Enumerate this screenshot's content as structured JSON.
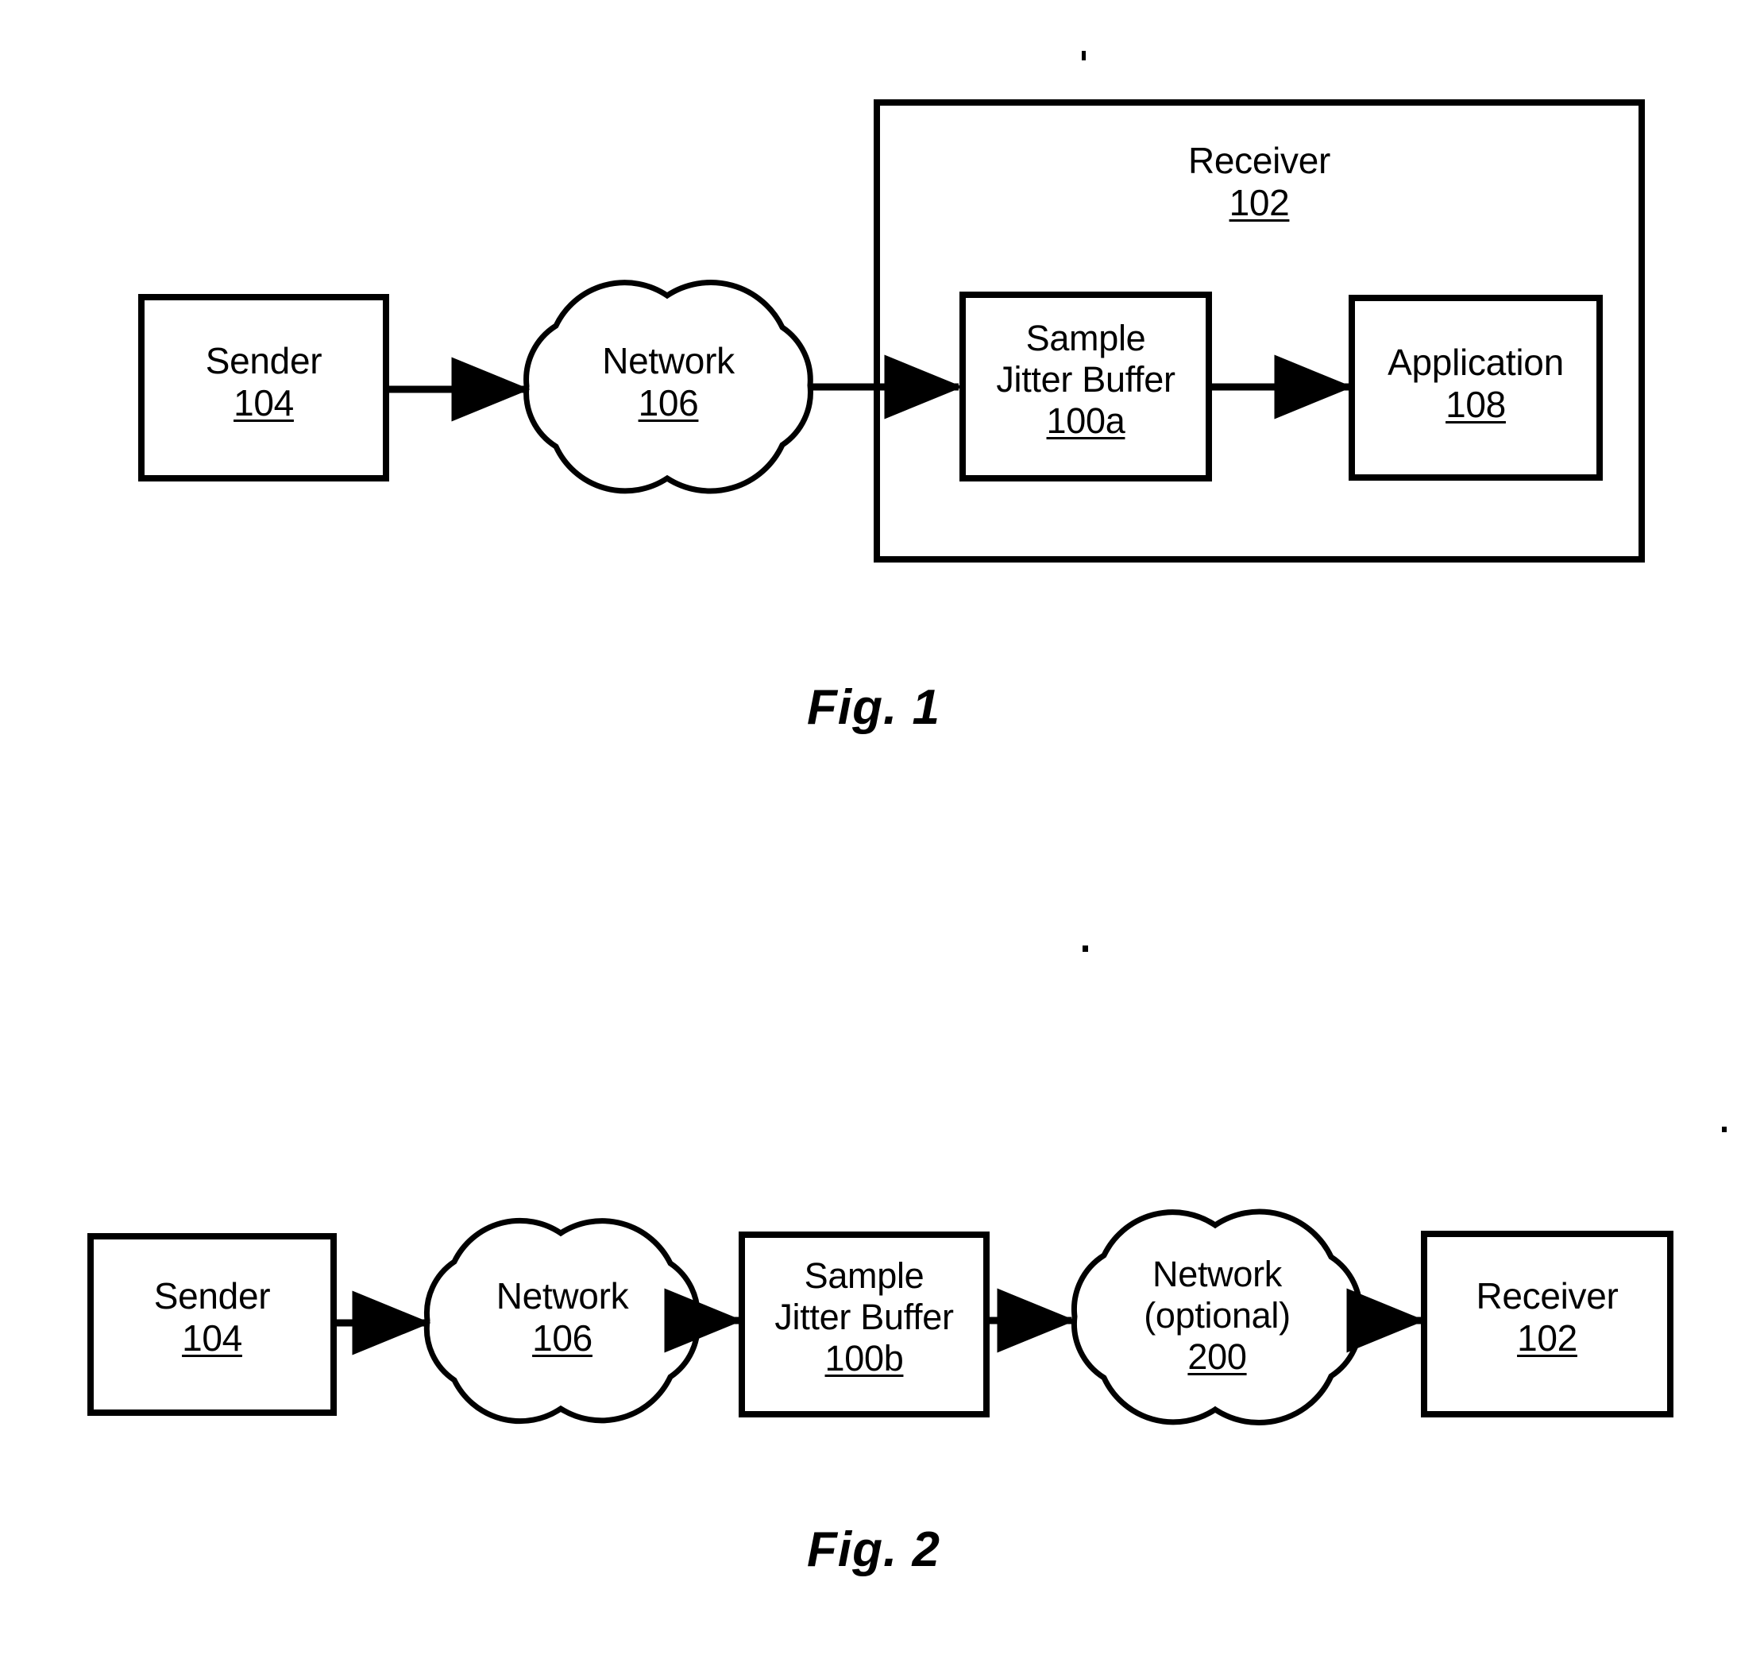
{
  "document": {
    "kind": "patent-figure-sheet",
    "figure_count": 2
  },
  "figures": [
    {
      "id": "fig-1",
      "caption": "Fig. 1",
      "nodes": [
        {
          "id": "sender-1",
          "shape": "rect",
          "title": "Sender",
          "ref": "104"
        },
        {
          "id": "network-1",
          "shape": "cloud",
          "title": "Network",
          "ref": "106"
        },
        {
          "id": "receiver-1",
          "shape": "rect",
          "title": "Receiver",
          "ref": "102"
        },
        {
          "id": "jitter-buffer-1",
          "shape": "rect",
          "title": "Sample\nJitter Buffer",
          "title_line1": "Sample",
          "title_line2": "Jitter Buffer",
          "ref": "100a"
        },
        {
          "id": "application-1",
          "shape": "rect",
          "title": "Application",
          "ref": "108"
        }
      ],
      "edges": [
        {
          "from": "sender-1",
          "to": "network-1"
        },
        {
          "from": "network-1",
          "to": "jitter-buffer-1"
        },
        {
          "from": "jitter-buffer-1",
          "to": "application-1"
        }
      ]
    },
    {
      "id": "fig-2",
      "caption": "Fig. 2",
      "nodes": [
        {
          "id": "sender-2",
          "shape": "rect",
          "title": "Sender",
          "ref": "104"
        },
        {
          "id": "network-2",
          "shape": "cloud",
          "title": "Network",
          "ref": "106"
        },
        {
          "id": "jitter-buffer-2",
          "shape": "rect",
          "title_line1": "Sample",
          "title_line2": "Jitter Buffer",
          "ref": "100b"
        },
        {
          "id": "network-opt-2",
          "shape": "cloud",
          "title_line1": "Network",
          "title_line2": "(optional)",
          "ref": "200"
        },
        {
          "id": "receiver-2",
          "shape": "rect",
          "title": "Receiver",
          "ref": "102"
        }
      ],
      "edges": [
        {
          "from": "sender-2",
          "to": "network-2"
        },
        {
          "from": "network-2",
          "to": "jitter-buffer-2"
        },
        {
          "from": "jitter-buffer-2",
          "to": "network-opt-2"
        },
        {
          "from": "network-opt-2",
          "to": "receiver-2"
        }
      ]
    }
  ],
  "style": {
    "ink": "#000000",
    "paper": "#ffffff"
  }
}
